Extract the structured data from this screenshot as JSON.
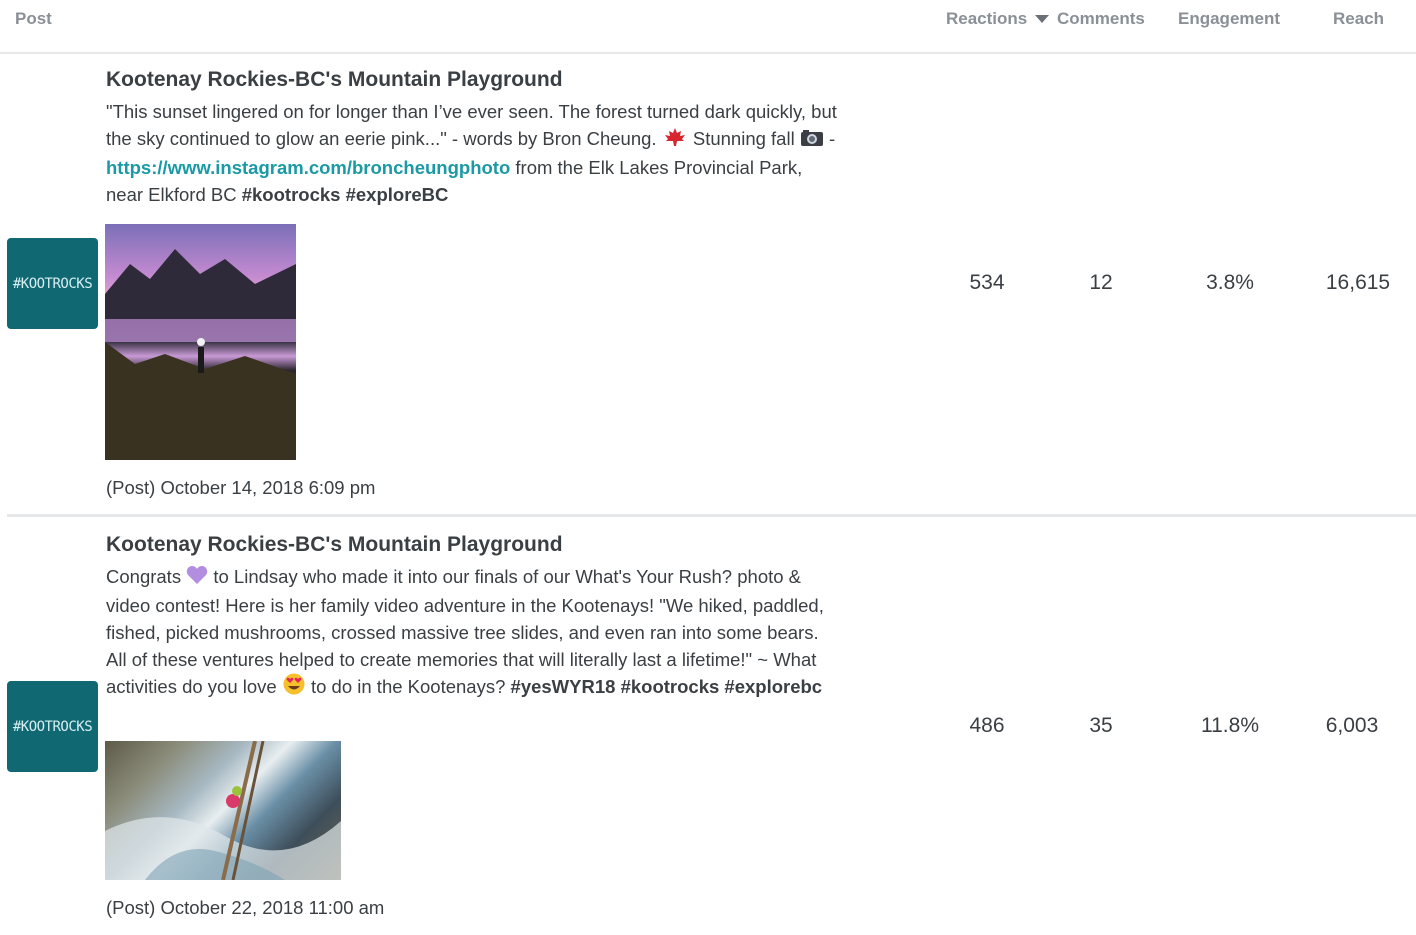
{
  "header": {
    "post": "Post",
    "reactions": "Reactions",
    "comments": "Comments",
    "engagement": "Engagement",
    "reach": "Reach",
    "sort_icon": "caret-down-icon"
  },
  "posts": [
    {
      "avatar_text": "#KOOTROCKS",
      "page_name": "Kootenay Rockies-BC's Mountain Playground",
      "text_1": "\"This sunset lingered on for longer than I’ve ever seen. The forest turned dark quickly, but the sky continued to glow an eerie pink...\" - words by Bron Cheung.",
      "text_2": "Stunning fall",
      "text_3": " - ",
      "link": "https://www.instagram.com/broncheungphoto",
      "text_4": "from the Elk Lakes Provincial Park, near Elkford BC",
      "hashtags": "#kootrocks #exploreBC",
      "icon_a": "maple-leaf-icon",
      "icon_b": "camera-icon",
      "date": "(Post) October 14, 2018 6:09 pm",
      "reactions": "534",
      "comments": "12",
      "engagement": "3.8%",
      "reach": "16,615"
    },
    {
      "avatar_text": "#KOOTROCKS",
      "page_name": "Kootenay Rockies-BC's Mountain Playground",
      "text_1": "Congrats",
      "text_2": "to Lindsay who made it into our finals of our What's Your Rush? photo & video contest! Here is her family video adventure in the Kootenays! \"We hiked, paddled, fished, picked mushrooms, crossed massive tree slides, and even ran into some bears. All of these ventures helped to create memories that will literally last a lifetime!\" ~ What activities do you love",
      "text_3": "to do in the Kootenays?",
      "hashtags": "#yesWYR18 #kootrocks #explorebc",
      "icon_a": "purple-heart-icon",
      "icon_b": "heart-eyes-emoji-icon",
      "date": "(Post) October 22, 2018 11:00 am",
      "reactions": "486",
      "comments": "35",
      "engagement": "11.8%",
      "reach": "6,003"
    }
  ],
  "colors": {
    "avatar_bg": "#0f6872",
    "link": "#1a9aa5",
    "header_text": "#8a9096",
    "separator": "#e6e7e8"
  }
}
